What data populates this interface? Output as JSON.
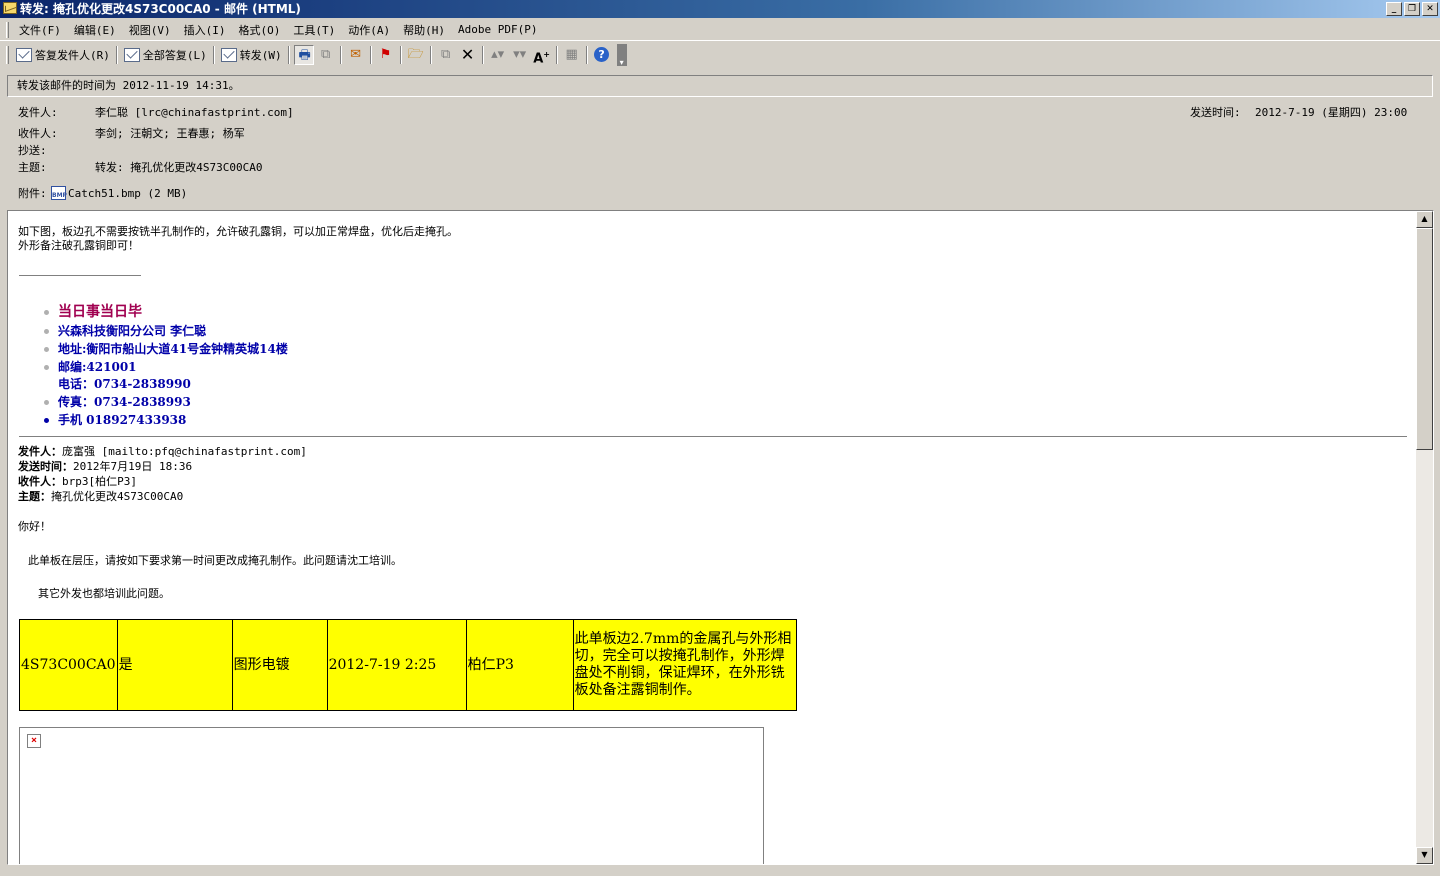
{
  "window": {
    "title": "转发: 掩孔优化更改4S73C00CA0 - 邮件 (HTML)"
  },
  "menu": [
    "文件(F)",
    "编辑(E)",
    "视图(V)",
    "插入(I)",
    "格式(O)",
    "工具(T)",
    "动作(A)",
    "帮助(H)",
    "Adobe PDF(P)"
  ],
  "toolbar": {
    "reply": "答复发件人(R)",
    "reply_all": "全部答复(L)",
    "forward": "转发(W)"
  },
  "infobar": "转发该邮件的时间为 2012-11-19 14:31。",
  "header": {
    "from_label": "发件人:",
    "from": "李仁聪 [lrc@chinafastprint.com]",
    "sent_label": "发送时间:",
    "sent": "2012-7-19 (星期四) 23:00",
    "to_label": "收件人:",
    "to": "李剑; 汪朝文; 王春惠; 杨军",
    "cc_label": "抄送:",
    "cc": "",
    "subject_label": "主题:",
    "subject": "转发: 掩孔优化更改4S73C00CA0",
    "attach_label": "附件:",
    "attachment": "Catch51.bmp (2 MB)"
  },
  "body": {
    "line1": "如下图，板边孔不需要按铣半孔制作的，允许破孔露铜，可以加正常焊盘，优化后走掩孔。",
    "line2": "外形备注破孔露铜即可！",
    "signature": {
      "motto": "当日事当日毕",
      "company": " 兴森科技衡阳分公司  李仁聪",
      "address": "地址:衡阳市船山大道41号金钟精英城14楼",
      "zip": "邮编:421001",
      "phone": "电话：0734-2838990",
      "fax": "传真：0734-2838993",
      "mobile": "手机  018927433938"
    },
    "fwd": {
      "from_label": "发件人：",
      "from": "庞富强 [mailto:pfq@chinafastprint.com]",
      "sent_label": "发送时间：",
      "sent": "2012年7月19日 18:36",
      "to_label": "收件人：",
      "to": "brp3[柏仁P3]",
      "subject_label": "主题：",
      "subject": "掩孔优化更改4S73C00CA0"
    },
    "greeting": "你好！",
    "para1": "此单板在层压，请按如下要求第一时间更改成掩孔制作。此问题请沈工培训。",
    "para2": "其它外发也都培训此问题。",
    "table": [
      "4S73C00CA0",
      "是",
      "图形电镀",
      "2012-7-19 2:25",
      "柏仁P3",
      "此单板边2.7mm的金属孔与外形相切，完全可以按掩孔制作，外形焊盘处不削铜，保证焊环，在外形铣板处备注露铜制作。"
    ]
  }
}
